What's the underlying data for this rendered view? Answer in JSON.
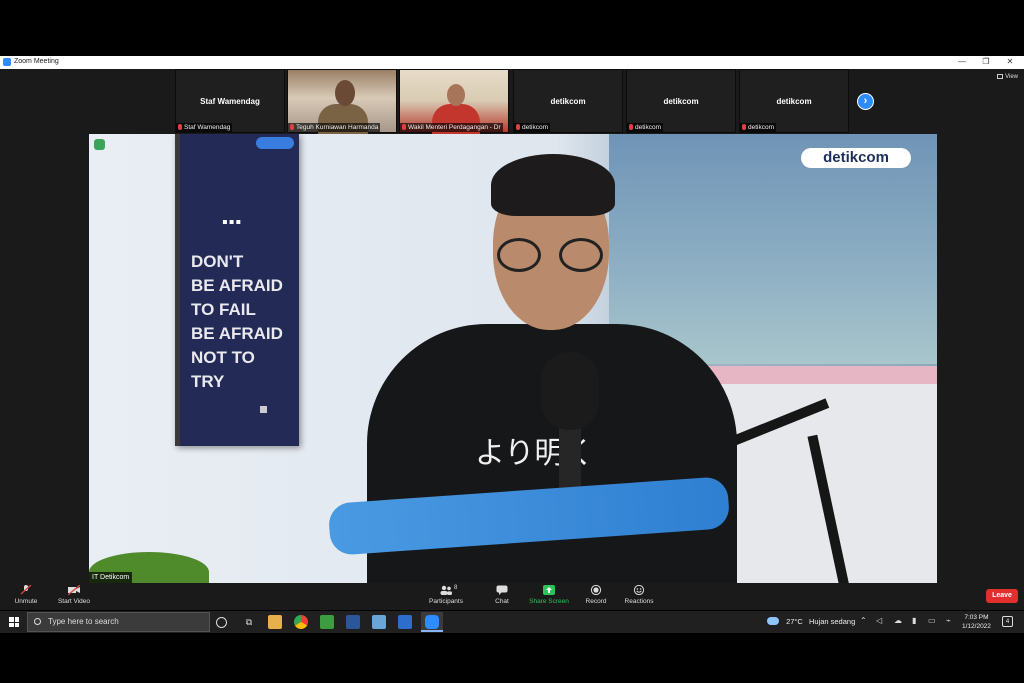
{
  "window": {
    "title": "Zoom Meeting",
    "controls": {
      "minimize": "—",
      "restore": "❐",
      "close": "✕"
    }
  },
  "view_button": {
    "label": "View"
  },
  "participants_strip": [
    {
      "big_name": "Staf Wamendag",
      "caption": "Staf Wamendag",
      "has_video": false
    },
    {
      "big_name": "",
      "caption": "Teguh Kurniawan Harmanda",
      "has_video": true
    },
    {
      "big_name": "",
      "caption": "Wakil Menteri Perdagangan - Dr",
      "has_video": true
    },
    {
      "big_name": "detikcom",
      "caption": "detikcom",
      "has_video": false
    },
    {
      "big_name": "detikcom",
      "caption": "detikcom",
      "has_video": false
    },
    {
      "big_name": "detikcom",
      "caption": "detikcom",
      "has_video": false
    }
  ],
  "strip_next_icon": "›",
  "main_video": {
    "brand_logo": "detikcom",
    "poster_dots": "▪▪▪",
    "poster_text": "DON'T\nBE AFRAID\nTO FAIL\nBE AFRAID\nNOT TO\nTRY",
    "shirt_text": "より明く",
    "speaker_name": "IT Detikcom"
  },
  "toolbar": {
    "unmute": "Unmute",
    "start_video": "Start Video",
    "participants": "Participants",
    "participants_count": "8",
    "chat": "Chat",
    "share_screen": "Share Screen",
    "record": "Record",
    "reactions": "Reactions",
    "leave": "Leave"
  },
  "taskbar": {
    "search_placeholder": "Type here to search",
    "weather_temp": "27°C",
    "weather_desc": "Hujan sedang",
    "time": "7:03 PM",
    "date": "1/12/2022",
    "notifications": "4"
  },
  "colors": {
    "zoom_blue": "#2d8cff",
    "leave_red": "#e0302d",
    "share_green": "#2ec25a"
  }
}
